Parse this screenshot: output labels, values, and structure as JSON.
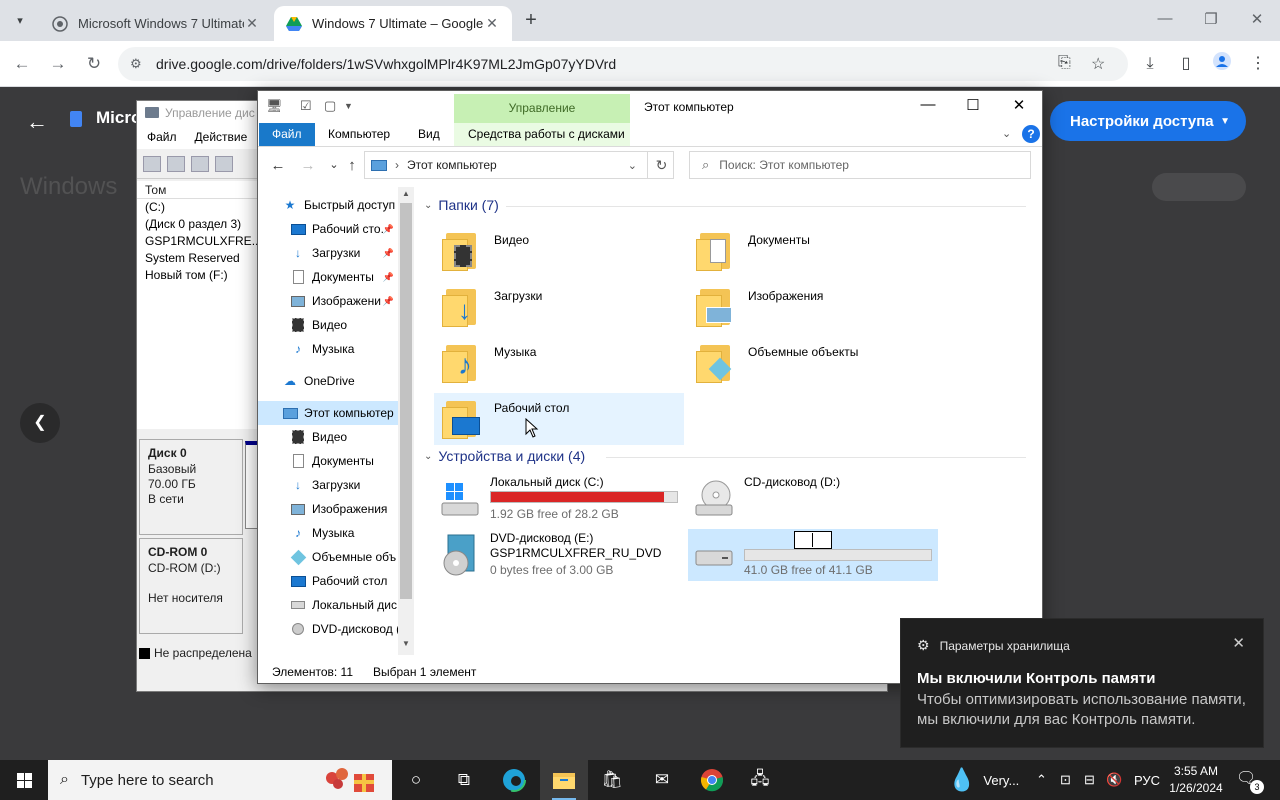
{
  "browser": {
    "tabs": [
      {
        "label": "Microsoft Windows 7 Ultimate ",
        "active": false
      },
      {
        "label": "Windows 7 Ultimate – Google Д",
        "active": true
      }
    ],
    "url": "drive.google.com/drive/folders/1wSVwhxgolMPlr4K97ML2JmGp07yYDVrd"
  },
  "drive": {
    "title": "Micro",
    "bg_title": "Windows",
    "share_button": "Настройки доступа"
  },
  "diskmgmt": {
    "title": "Управление дис",
    "menu": [
      "Файл",
      "Действие"
    ],
    "volume_header": "Том",
    "volumes": [
      "(C:)",
      "(Диск 0 раздел 3)",
      "GSP1RMCULXFRE...",
      "System Reserved",
      "Новый том (F:)"
    ],
    "disk0": {
      "name": "Диск 0",
      "type": "Базовый",
      "size": "70.00 ГБ",
      "status": "В сети"
    },
    "cdrom0": {
      "name": "CD-ROM 0",
      "drive": "CD-ROM (D:)",
      "status": "Нет носителя"
    },
    "unallocated": "Не распределена"
  },
  "explorer": {
    "title": "Этот компьютер",
    "ribbon_context": "Управление",
    "ribbon_tabs": [
      "Файл",
      "Компьютер",
      "Вид",
      "Средства работы с дисками"
    ],
    "address": "Этот компьютер",
    "search_placeholder": "Поиск: Этот компьютер",
    "nav": [
      {
        "label": "Быстрый доступ",
        "icon": "star-icon",
        "pinned": false
      },
      {
        "label": "Рабочий сто.",
        "icon": "desktop-icon",
        "pinned": true
      },
      {
        "label": "Загрузки",
        "icon": "download-icon",
        "pinned": true
      },
      {
        "label": "Документы",
        "icon": "document-icon",
        "pinned": true
      },
      {
        "label": "Изображени",
        "icon": "image-icon",
        "pinned": true
      },
      {
        "label": "Видео",
        "icon": "video-icon",
        "pinned": false
      },
      {
        "label": "Музыка",
        "icon": "music-icon",
        "pinned": false
      },
      {
        "label": "OneDrive",
        "icon": "cloud-icon",
        "pinned": false
      },
      {
        "label": "Этот компьютер",
        "icon": "computer-icon",
        "pinned": false
      },
      {
        "label": "Видео",
        "icon": "video-icon",
        "pinned": false
      },
      {
        "label": "Документы",
        "icon": "document-icon",
        "pinned": false
      },
      {
        "label": "Загрузки",
        "icon": "download-icon",
        "pinned": false
      },
      {
        "label": "Изображения",
        "icon": "image-icon",
        "pinned": false
      },
      {
        "label": "Музыка",
        "icon": "music-icon",
        "pinned": false
      },
      {
        "label": "Объемные объ",
        "icon": "cube-icon",
        "pinned": false
      },
      {
        "label": "Рабочий стол",
        "icon": "desktop-icon",
        "pinned": false
      },
      {
        "label": "Локальный дис",
        "icon": "drive-icon",
        "pinned": false
      },
      {
        "label": "DVD-дисковод (",
        "icon": "dvd-icon",
        "pinned": false
      }
    ],
    "folders_header": "Папки (7)",
    "folders": [
      {
        "label": "Видео",
        "icon": "video-folder-icon"
      },
      {
        "label": "Документы",
        "icon": "documents-folder-icon"
      },
      {
        "label": "Загрузки",
        "icon": "downloads-folder-icon"
      },
      {
        "label": "Изображения",
        "icon": "pictures-folder-icon"
      },
      {
        "label": "Музыка",
        "icon": "music-folder-icon"
      },
      {
        "label": "Объемные объекты",
        "icon": "3d-objects-folder-icon"
      },
      {
        "label": "Рабочий стол",
        "icon": "desktop-folder-icon"
      }
    ],
    "devices_header": "Устройства и диски (4)",
    "drives": [
      {
        "name": "Локальный диск (C:)",
        "free": "1.92 GB free of 28.2 GB",
        "used_fraction": 0.93,
        "bar_color": "#da2626"
      },
      {
        "name": "CD-дисковод (D:)",
        "free": "",
        "used_fraction": null,
        "bar_color": ""
      },
      {
        "name": "DVD-дисковод (E:)",
        "name2": "GSP1RMCULXFRER_RU_DVD",
        "free": "0 bytes free of 3.00 GB",
        "used_fraction": null,
        "bar_color": ""
      },
      {
        "name": "",
        "free": "41.0 GB free of 41.1 GB",
        "used_fraction": 0.0,
        "bar_color": "#26a0da"
      }
    ],
    "status_count": "Элементов: 11",
    "status_selected": "Выбран 1 элемент"
  },
  "toast": {
    "app": "Параметры хранилища",
    "title": "Мы включили Контроль памяти",
    "body": "Чтобы оптимизировать использование памяти, мы включили для вас Контроль памяти."
  },
  "taskbar": {
    "search_placeholder": "Type here to search",
    "weather": "Very...",
    "language": "РУС",
    "time": "3:55 AM",
    "date": "1/26/2024",
    "notifications": "3"
  }
}
